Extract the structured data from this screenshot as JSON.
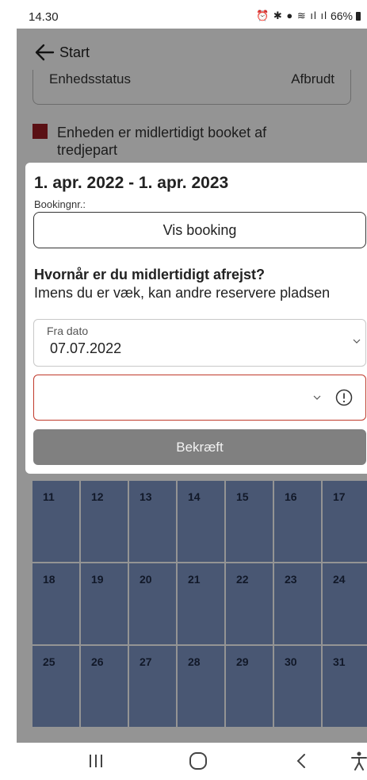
{
  "status_bar": {
    "time": "14.30",
    "battery": "66%",
    "icons": [
      "alarm-icon",
      "bluetooth-icon",
      "location-icon",
      "wifi-icon",
      "signal-icon",
      "signal-icon",
      "battery-icon"
    ]
  },
  "header": {
    "title": "Start"
  },
  "unit_status": {
    "label": "Enhedsstatus",
    "value": "Afbrudt"
  },
  "legend": {
    "text": "Enheden er midlertidigt booket af tredjepart",
    "color": "#9b1c24"
  },
  "calendar": {
    "rows": [
      [
        "11",
        "12",
        "13",
        "14",
        "15",
        "16",
        "17"
      ],
      [
        "18",
        "19",
        "20",
        "21",
        "22",
        "23",
        "24"
      ],
      [
        "25",
        "26",
        "27",
        "28",
        "29",
        "30",
        "31"
      ]
    ],
    "color": "#7f97c7"
  },
  "dialog": {
    "period": "1. apr. 2022 - 1. apr. 2023",
    "booking_nr_label": "Bookingnr.:",
    "vis_booking_label": "Vis booking",
    "question_title": "Hvornår er du midlertidigt afrejst?",
    "question_sub": "Imens du er væk, kan andre reservere pladsen",
    "from_label": "Fra dato",
    "from_value": "07.07.2022",
    "to_value": "",
    "confirm_label": "Bekræft",
    "error_color": "#c0392b"
  },
  "nav": {
    "items": [
      "recents-icon",
      "home-icon",
      "back-icon",
      "accessibility-icon"
    ]
  }
}
